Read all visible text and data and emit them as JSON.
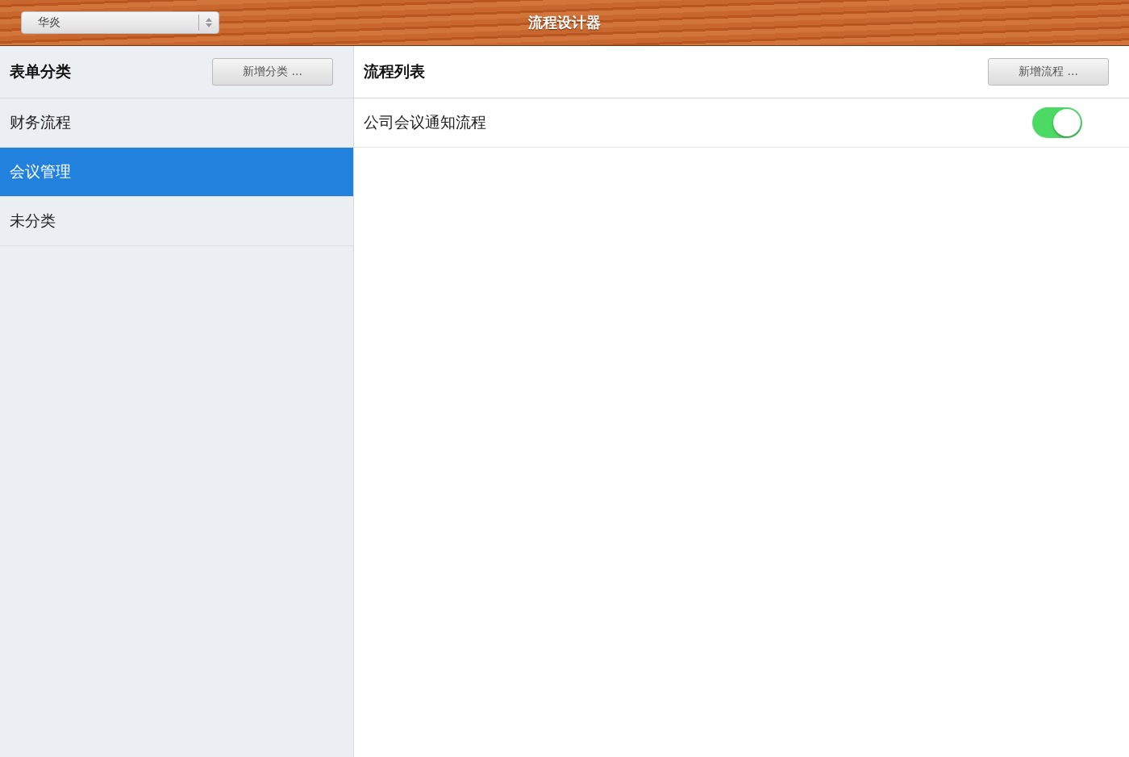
{
  "header": {
    "title": "流程设计器",
    "select": {
      "value": "华炎"
    }
  },
  "sidebar": {
    "title": "表单分类",
    "add_button": "新增分类 ...",
    "items": [
      {
        "label": "财务流程",
        "selected": false
      },
      {
        "label": "会议管理",
        "selected": true
      },
      {
        "label": "未分类",
        "selected": false
      }
    ]
  },
  "main": {
    "title": "流程列表",
    "add_button": "新增流程 ...",
    "rows": [
      {
        "label": "公司会议通知流程",
        "on": true
      }
    ]
  }
}
